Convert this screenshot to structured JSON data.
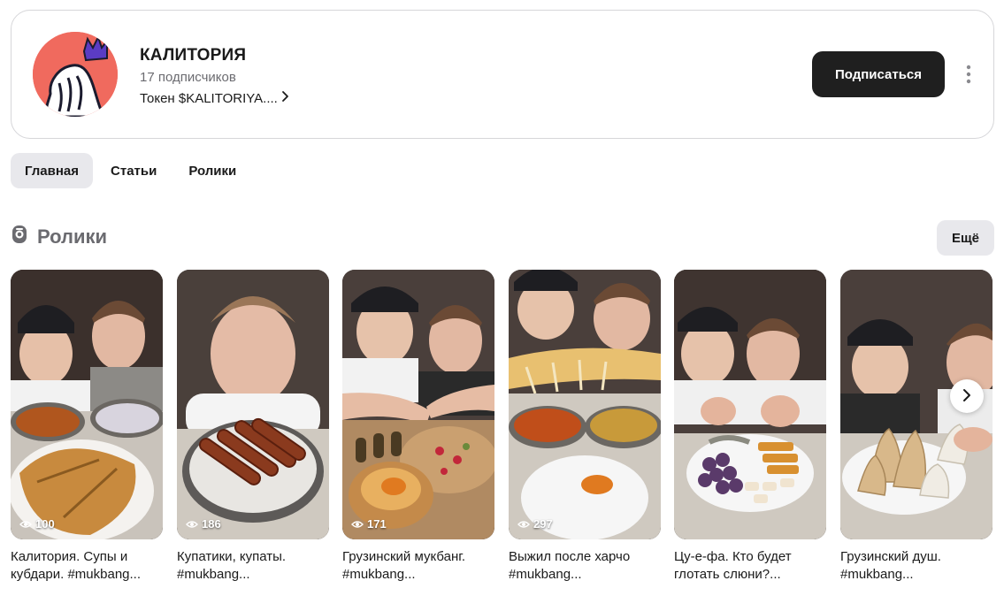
{
  "channel": {
    "title": "КАЛИТОРИЯ",
    "subscribers": "17 подписчиков",
    "token_link": "Токен $KALITORIYA....",
    "subscribe_label": "Подписаться",
    "avatar_bg": "#f06a5e",
    "avatar_crown_color": "#5b3cc4"
  },
  "tabs": [
    {
      "label": "Главная",
      "active": true
    },
    {
      "label": "Статьи",
      "active": false
    },
    {
      "label": "Ролики",
      "active": false
    }
  ],
  "section": {
    "title": "Ролики",
    "more_label": "Ещё"
  },
  "videos": [
    {
      "views": "100",
      "title_line1": "Калитория. Супы и",
      "title_line2": "кубдари. #mukbang..."
    },
    {
      "views": "186",
      "title_line1": "Купатики, купаты.",
      "title_line2": "#mukbang..."
    },
    {
      "views": "171",
      "title_line1": "Грузинский мукбанг.",
      "title_line2": "#mukbang..."
    },
    {
      "views": "297",
      "title_line1": "Выжил после харчо",
      "title_line2": "#mukbang..."
    },
    {
      "views": "",
      "title_line1": "Цу-е-фа. Кто будет",
      "title_line2": "глотать слюни?..."
    },
    {
      "views": "",
      "title_line1": "Грузинский душ.",
      "title_line2": "#mukbang..."
    }
  ],
  "icons": {
    "more": "more-vertical-icon",
    "chevron": "chevron-right-icon",
    "views": "eye-icon",
    "section": "shorts-icon",
    "next": "next-arrow-icon"
  },
  "colors": {
    "primary_button": "#1f1f1f",
    "tab_active_bg": "#e8e8ec",
    "muted_text": "#6b6b70"
  }
}
